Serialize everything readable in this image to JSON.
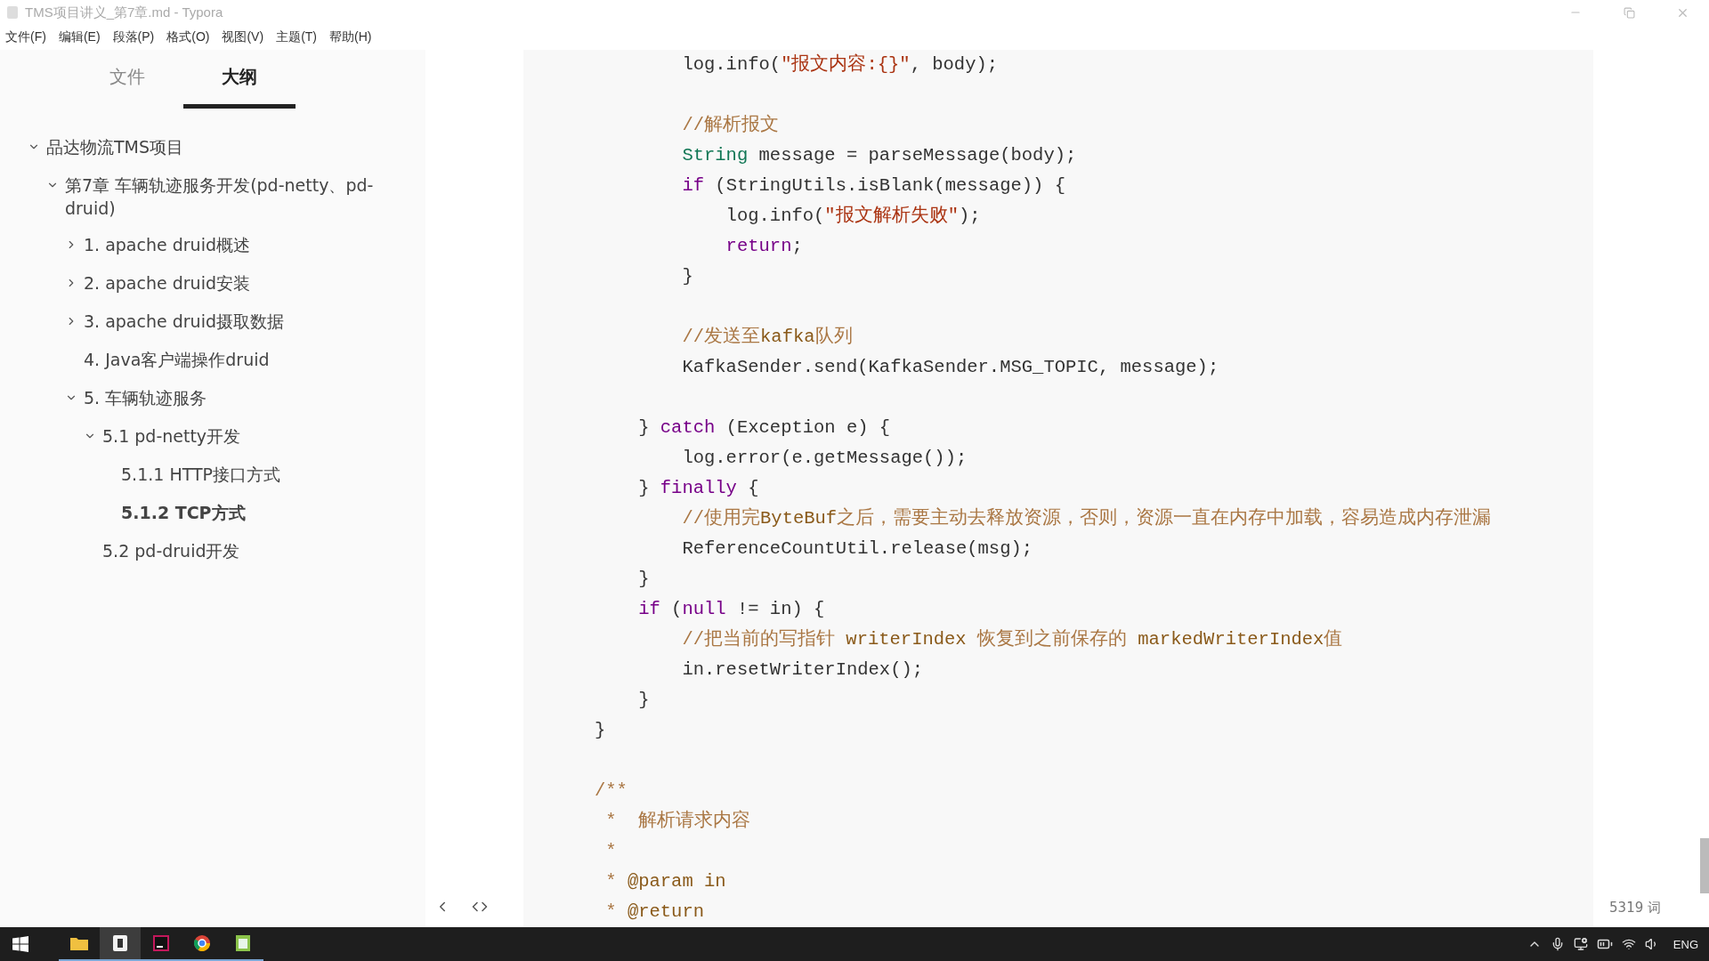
{
  "window": {
    "title": "TMS项目讲义_第7章.md - Typora"
  },
  "menu": [
    "文件(F)",
    "编辑(E)",
    "段落(P)",
    "格式(O)",
    "视图(V)",
    "主题(T)",
    "帮助(H)"
  ],
  "sidebar": {
    "tabs": [
      {
        "label": "文件",
        "selected": false
      },
      {
        "label": "大纲",
        "selected": true
      }
    ],
    "outline": [
      {
        "label": "品达物流TMS项目",
        "expanded": true,
        "selected": false,
        "children": [
          {
            "label": "第7章 车辆轨迹服务开发(pd-netty、pd-druid)",
            "expanded": true,
            "selected": false,
            "children": [
              {
                "label": "1. apache druid概述",
                "expanded": false,
                "selected": false
              },
              {
                "label": "2. apache druid安装",
                "expanded": false,
                "selected": false
              },
              {
                "label": "3. apache druid摄取数据",
                "expanded": false,
                "selected": false
              },
              {
                "label": "4. Java客户端操作druid",
                "selected": false
              },
              {
                "label": "5. 车辆轨迹服务",
                "expanded": true,
                "selected": false,
                "children": [
                  {
                    "label": "5.1 pd-netty开发",
                    "expanded": true,
                    "selected": false,
                    "children": [
                      {
                        "label": "5.1.1 HTTP接口方式",
                        "selected": false
                      },
                      {
                        "label": "5.1.2 TCP方式",
                        "selected": true
                      }
                    ]
                  },
                  {
                    "label": "5.2 pd-druid开发",
                    "selected": false
                  }
                ]
              }
            ]
          }
        ]
      }
    ]
  },
  "code": [
    {
      "kind": "code",
      "tokens": [
        {
          "kind": "plain",
          "text": "        log.info("
        },
        {
          "kind": "string",
          "text": "\"报文内容:{}\""
        },
        {
          "kind": "plain",
          "text": ", body);"
        }
      ]
    },
    {
      "kind": "blank"
    },
    {
      "kind": "code",
      "tokens": [
        {
          "kind": "comment",
          "text": "        //解析报文"
        }
      ]
    },
    {
      "kind": "code",
      "tokens": [
        {
          "kind": "type",
          "text": "        String"
        },
        {
          "kind": "plain",
          "text": " message = parseMessage(body);"
        }
      ]
    },
    {
      "kind": "code",
      "tokens": [
        {
          "kind": "keyword",
          "text": "        if"
        },
        {
          "kind": "plain",
          "text": " (StringUtils.isBlank(message)) {"
        }
      ]
    },
    {
      "kind": "code",
      "tokens": [
        {
          "kind": "plain",
          "text": "            log.info("
        },
        {
          "kind": "string",
          "text": "\"报文解析失败\""
        },
        {
          "kind": "plain",
          "text": ");"
        }
      ]
    },
    {
      "kind": "code",
      "tokens": [
        {
          "kind": "keyword",
          "text": "            return"
        },
        {
          "kind": "plain",
          "text": ";"
        }
      ]
    },
    {
      "kind": "code",
      "tokens": [
        {
          "kind": "plain",
          "text": "        }"
        }
      ]
    },
    {
      "kind": "blank"
    },
    {
      "kind": "code",
      "tokens": [
        {
          "kind": "comment",
          "text": "        //发送至"
        },
        {
          "kind": "comment_code",
          "text": "kafka"
        },
        {
          "kind": "comment",
          "text": "队列"
        }
      ]
    },
    {
      "kind": "code",
      "tokens": [
        {
          "kind": "plain",
          "text": "        KafkaSender.send(KafkaSender.MSG_TOPIC, message);"
        }
      ]
    },
    {
      "kind": "blank"
    },
    {
      "kind": "code",
      "tokens": [
        {
          "kind": "plain",
          "text": "    } "
        },
        {
          "kind": "keyword",
          "text": "catch"
        },
        {
          "kind": "plain",
          "text": " (Exception e) {"
        }
      ]
    },
    {
      "kind": "code",
      "tokens": [
        {
          "kind": "plain",
          "text": "        log.error(e.getMessage());"
        }
      ]
    },
    {
      "kind": "code",
      "tokens": [
        {
          "kind": "plain",
          "text": "    } "
        },
        {
          "kind": "keyword",
          "text": "finally"
        },
        {
          "kind": "plain",
          "text": " {"
        }
      ]
    },
    {
      "kind": "code",
      "tokens": [
        {
          "kind": "comment",
          "text": "        //使用完"
        },
        {
          "kind": "comment_code",
          "text": "ByteBuf"
        },
        {
          "kind": "comment",
          "text": "之后，需要主动去释放资源，否则，资源一直在内存中加载，容易造成内存泄漏"
        }
      ]
    },
    {
      "kind": "code",
      "tokens": [
        {
          "kind": "plain",
          "text": "        ReferenceCountUtil.release(msg);"
        }
      ]
    },
    {
      "kind": "code",
      "tokens": [
        {
          "kind": "plain",
          "text": "    }"
        }
      ]
    },
    {
      "kind": "code",
      "tokens": [
        {
          "kind": "keyword",
          "text": "    if"
        },
        {
          "kind": "plain",
          "text": " ("
        },
        {
          "kind": "keyword",
          "text": "null"
        },
        {
          "kind": "plain",
          "text": " != in) {"
        }
      ]
    },
    {
      "kind": "code",
      "tokens": [
        {
          "kind": "comment",
          "text": "        //把当前的写指针 "
        },
        {
          "kind": "comment_code",
          "text": "writerIndex"
        },
        {
          "kind": "comment",
          "text": " 恢复到之前保存的 "
        },
        {
          "kind": "comment_code",
          "text": "markedWriterIndex"
        },
        {
          "kind": "comment",
          "text": "值"
        }
      ]
    },
    {
      "kind": "code",
      "tokens": [
        {
          "kind": "plain",
          "text": "        in.resetWriterIndex();"
        }
      ]
    },
    {
      "kind": "code",
      "tokens": [
        {
          "kind": "plain",
          "text": "    }"
        }
      ]
    },
    {
      "kind": "code",
      "tokens": [
        {
          "kind": "plain",
          "text": "}"
        }
      ]
    },
    {
      "kind": "blank"
    },
    {
      "kind": "code",
      "tokens": [
        {
          "kind": "comment",
          "text": "/**"
        }
      ]
    },
    {
      "kind": "code",
      "tokens": [
        {
          "kind": "comment",
          "text": " *  解析请求内容"
        }
      ]
    },
    {
      "kind": "code",
      "tokens": [
        {
          "kind": "comment",
          "text": " *"
        }
      ]
    },
    {
      "kind": "code",
      "tokens": [
        {
          "kind": "comment",
          "text": " * "
        },
        {
          "kind": "comment_code",
          "text": "@param in"
        }
      ]
    },
    {
      "kind": "code",
      "tokens": [
        {
          "kind": "comment",
          "text": " * "
        },
        {
          "kind": "comment_code",
          "text": "@return"
        }
      ]
    }
  ],
  "status_bar": {
    "word_count": "5319 词"
  },
  "taskbar": {
    "language": "ENG"
  }
}
